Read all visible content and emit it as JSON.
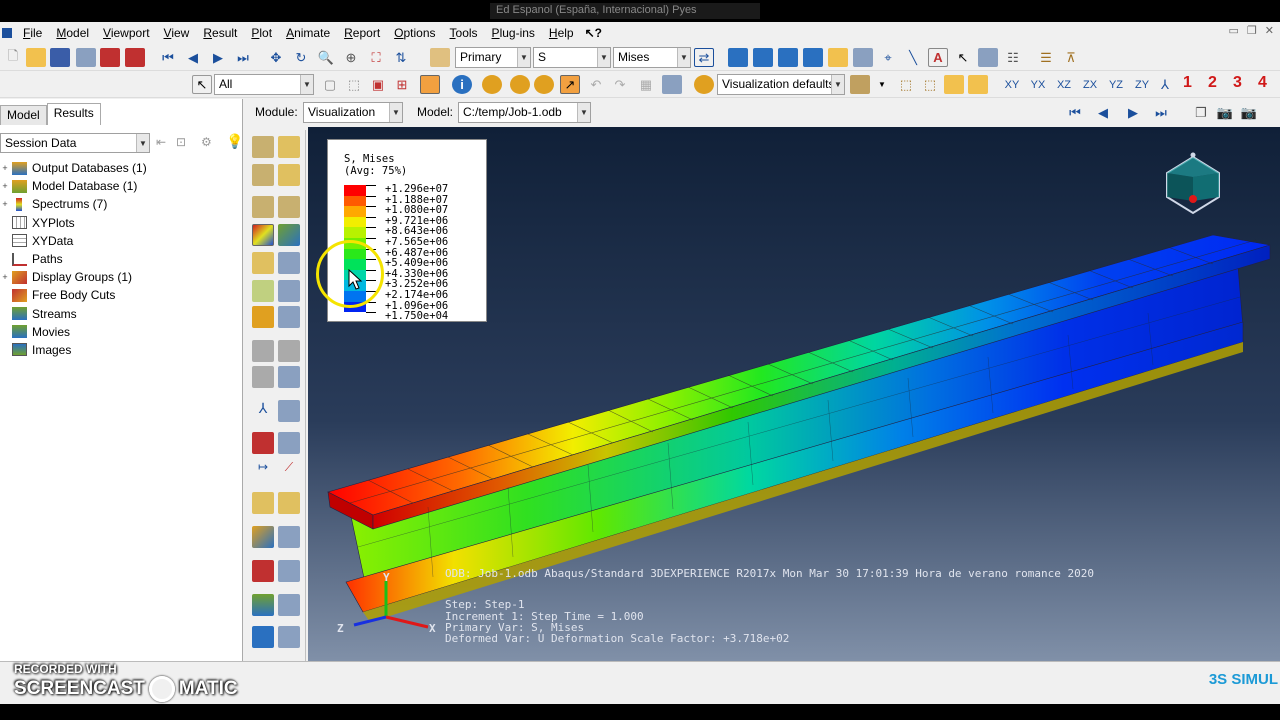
{
  "window": {
    "title": "Ed Espanol (España, Internacional)  Pyes"
  },
  "menu": [
    "File",
    "Model",
    "Viewport",
    "View",
    "Result",
    "Plot",
    "Animate",
    "Report",
    "Options",
    "Tools",
    "Plug-ins",
    "Help"
  ],
  "toolbar": {
    "primary_label": "Primary",
    "variable": "S",
    "invariant": "Mises",
    "selection_filter": "All",
    "visualization_defaults": "Visualization defaults",
    "step_numbers": [
      "1",
      "2",
      "3",
      "4"
    ]
  },
  "context": {
    "module_label": "Module:",
    "module_value": "Visualization",
    "model_label": "Model:",
    "model_value": "C:/temp/Job-1.odb"
  },
  "left_panel": {
    "tabs": [
      "Model",
      "Results"
    ],
    "active_tab": "Results",
    "session_combo": "Session Data",
    "tree": [
      {
        "label": "Output Databases (1)",
        "expandable": true
      },
      {
        "label": "Model Database (1)",
        "expandable": true
      },
      {
        "label": "Spectrums (7)",
        "expandable": true
      },
      {
        "label": "XYPlots",
        "expandable": false
      },
      {
        "label": "XYData",
        "expandable": false
      },
      {
        "label": "Paths",
        "expandable": false
      },
      {
        "label": "Display Groups (1)",
        "expandable": true
      },
      {
        "label": "Free Body Cuts",
        "expandable": false
      },
      {
        "label": "Streams",
        "expandable": false
      },
      {
        "label": "Movies",
        "expandable": false
      },
      {
        "label": "Images",
        "expandable": false
      }
    ]
  },
  "legend": {
    "title": "S, Mises\n(Avg: 75%)",
    "values": [
      "+1.296e+07",
      "+1.188e+07",
      "+1.080e+07",
      "+9.721e+06",
      "+8.643e+06",
      "+7.565e+06",
      "+6.487e+06",
      "+5.409e+06",
      "+4.330e+06",
      "+3.252e+06",
      "+2.174e+06",
      "+1.096e+06",
      "+1.750e+04"
    ],
    "colors": [
      "#ff0000",
      "#ff5a00",
      "#ffa800",
      "#f2ee00",
      "#b8f200",
      "#73ef00",
      "#2ae81a",
      "#00e25a",
      "#00d6a8",
      "#00b8e0",
      "#0074f0",
      "#0024f2"
    ]
  },
  "viewport_info": {
    "odb_line": "ODB: Job-1.odb    Abaqus/Standard 3DEXPERIENCE R2017x    Mon Mar 30 17:01:39 Hora de verano romance 2020",
    "step_line": "Step: Step-1",
    "increment_line": "Increment    1: Step Time =    1.000",
    "primary_line": "Primary Var: S, Mises",
    "deformed_line": "Deformed Var: U   Deformation Scale Factor: +3.718e+02"
  },
  "triad_labels": {
    "y": "Y",
    "z": "Z",
    "x": "X"
  },
  "watermark": {
    "line1": "RECORDED WITH",
    "line2_a": "SCREENCAST",
    "line2_b": "MATIC"
  },
  "brand": "3S SIMUL"
}
